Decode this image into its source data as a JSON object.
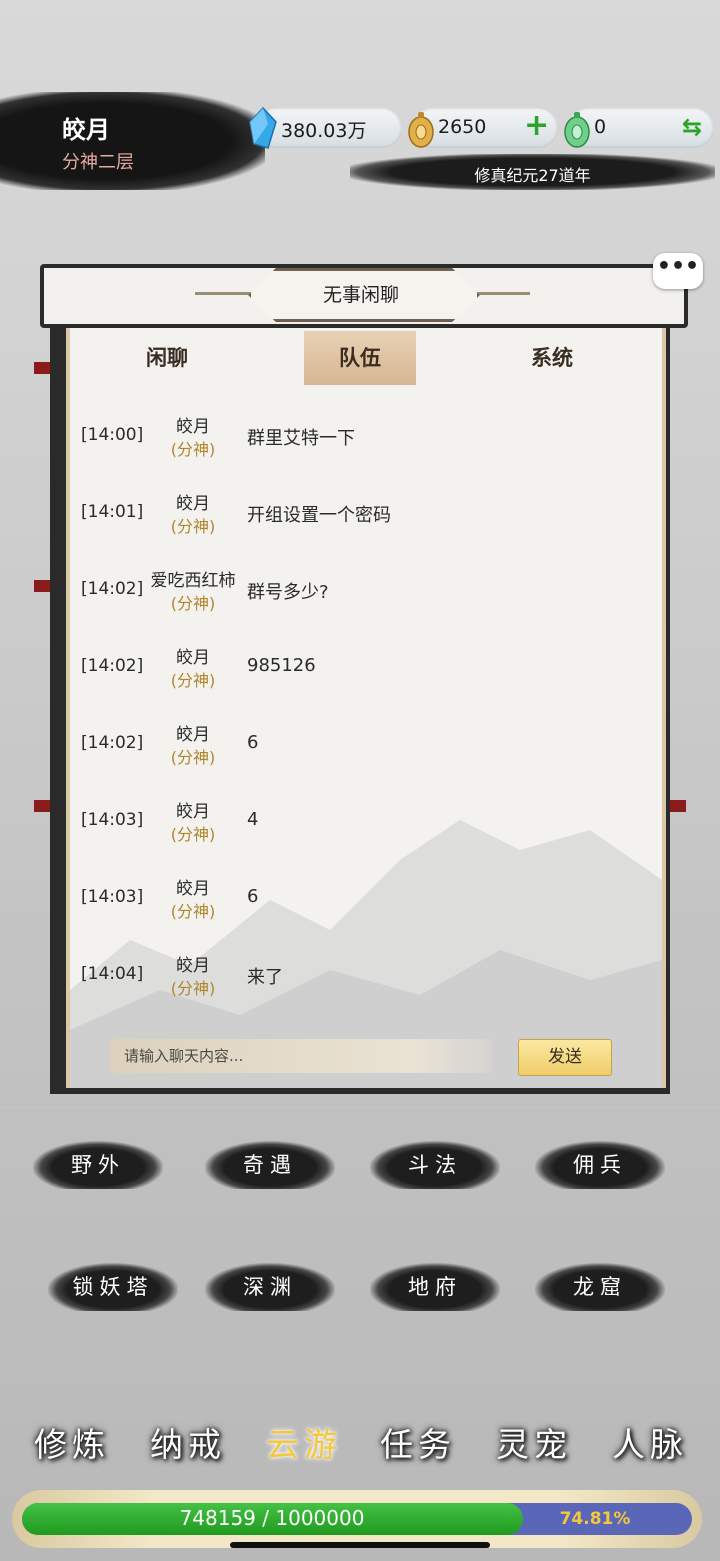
{
  "header": {
    "player_name": "皎月",
    "player_rank": "分神二层",
    "resources": [
      {
        "icon": "spirit-crystal-icon",
        "value": "380.03万"
      },
      {
        "icon": "gold-coin-icon",
        "value": "2650"
      },
      {
        "icon": "jade-coin-icon",
        "value": "0"
      }
    ],
    "plus_symbol": "+",
    "swap_symbol": "⇆",
    "era": "修真纪元27道年"
  },
  "chat": {
    "more_symbol": "•••",
    "title": "无事闲聊",
    "tabs": [
      {
        "label": "闲聊",
        "active": false
      },
      {
        "label": "队伍",
        "active": true
      },
      {
        "label": "系统",
        "active": false
      }
    ],
    "messages": [
      {
        "time": "[14:00]",
        "name": "皎月",
        "rank": "(分神)",
        "text": "群里艾特一下"
      },
      {
        "time": "[14:01]",
        "name": "皎月",
        "rank": "(分神)",
        "text": "开组设置一个密码"
      },
      {
        "time": "[14:02]",
        "name": "爱吃西红柿",
        "rank": "(分神)",
        "text": "群号多少?"
      },
      {
        "time": "[14:02]",
        "name": "皎月",
        "rank": "(分神)",
        "text": "985126"
      },
      {
        "time": "[14:02]",
        "name": "皎月",
        "rank": "(分神)",
        "text": "6"
      },
      {
        "time": "[14:03]",
        "name": "皎月",
        "rank": "(分神)",
        "text": "4"
      },
      {
        "time": "[14:03]",
        "name": "皎月",
        "rank": "(分神)",
        "text": "6"
      },
      {
        "time": "[14:04]",
        "name": "皎月",
        "rank": "(分神)",
        "text": "来了"
      }
    ],
    "input_placeholder": "请输入聊天内容...",
    "send_label": "发送"
  },
  "locations": [
    {
      "label": "野外"
    },
    {
      "label": "奇遇"
    },
    {
      "label": "斗法"
    },
    {
      "label": "佣兵"
    },
    {
      "label": "锁妖塔"
    },
    {
      "label": "深渊"
    },
    {
      "label": "地府"
    },
    {
      "label": "龙窟"
    }
  ],
  "nav": [
    {
      "label": "修炼",
      "active": false
    },
    {
      "label": "纳戒",
      "active": false
    },
    {
      "label": "云游",
      "active": true
    },
    {
      "label": "任务",
      "active": false
    },
    {
      "label": "灵宠",
      "active": false
    },
    {
      "label": "人脉",
      "active": false
    }
  ],
  "exp": {
    "text": "748159 / 1000000",
    "percent_label": "74.81%",
    "fraction": 0.7481
  },
  "colors": {
    "accent_gold": "#f5c73a",
    "exp_green": "#2aa52a",
    "rank_gold": "#b0862c",
    "rank_red": "#e7a9a0"
  }
}
